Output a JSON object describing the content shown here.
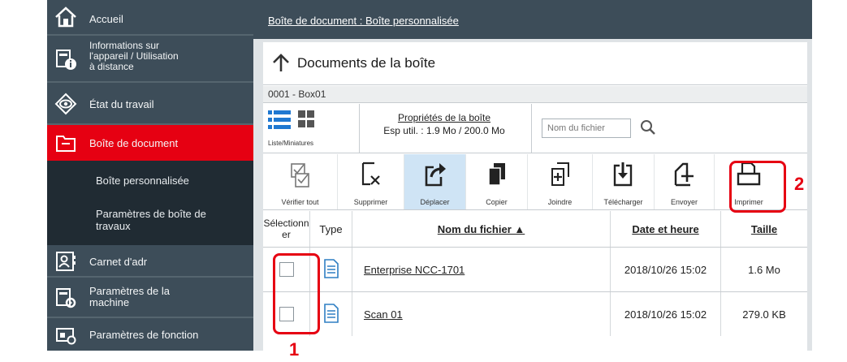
{
  "sidebar": {
    "items": [
      {
        "label": "Accueil",
        "icon": "home-icon"
      },
      {
        "label": "Informations sur\nl'appareil / Utilisation\nà distance",
        "icon": "device-info-icon"
      },
      {
        "label": "État du travail",
        "icon": "eye-icon"
      },
      {
        "label": "Boîte de document",
        "icon": "folder-icon",
        "active": true
      },
      {
        "label": "Carnet d'adr",
        "icon": "address-book-icon"
      },
      {
        "label": "Paramètres de la\nmachine",
        "icon": "machine-settings-icon"
      },
      {
        "label": "Paramètres de fonction",
        "icon": "function-settings-icon"
      }
    ],
    "subitems": [
      {
        "label": "Boîte personnalisée"
      },
      {
        "label": "Paramètres de boîte de\ntravaux"
      }
    ]
  },
  "breadcrumb": "Boîte de document : Boîte personnalisée",
  "page_title": "Documents de la boîte",
  "box_name": "0001 - Box01",
  "view": {
    "label": "Liste/Miniatures"
  },
  "properties": {
    "link": "Propriétés de la boîte",
    "usage": "Esp util. : 1.9 Mo / 200.0 Mo"
  },
  "search": {
    "placeholder": "Nom du fichier"
  },
  "toolbar": [
    {
      "label": "Vérifier tout",
      "icon": "check-all-icon"
    },
    {
      "label": "Supprimer",
      "icon": "delete-icon"
    },
    {
      "label": "Déplacer",
      "icon": "move-icon",
      "selected": true
    },
    {
      "label": "Copier",
      "icon": "copy-icon"
    },
    {
      "label": "Joindre",
      "icon": "join-icon"
    },
    {
      "label": "Télécharger",
      "icon": "download-icon"
    },
    {
      "label": "Envoyer",
      "icon": "send-icon"
    },
    {
      "label": "Imprimer",
      "icon": "print-icon"
    }
  ],
  "table": {
    "headers": {
      "select": "Sélectionn\ner",
      "type": "Type",
      "name": "Nom du fichier ▲",
      "date": "Date et heure",
      "size": "Taille"
    },
    "rows": [
      {
        "name": "Enterprise NCC-1701",
        "date": "2018/10/26 15:02",
        "size": "1.6 Mo"
      },
      {
        "name": "Scan 01",
        "date": "2018/10/26 15:02",
        "size": "279.0 KB"
      }
    ]
  },
  "callouts": {
    "one": "1",
    "two": "2"
  },
  "colors": {
    "accent_red": "#e60012",
    "sidebar": "#3d4d59",
    "file_icon": "#2f7fc3",
    "list_icon": "#1f78d1"
  }
}
